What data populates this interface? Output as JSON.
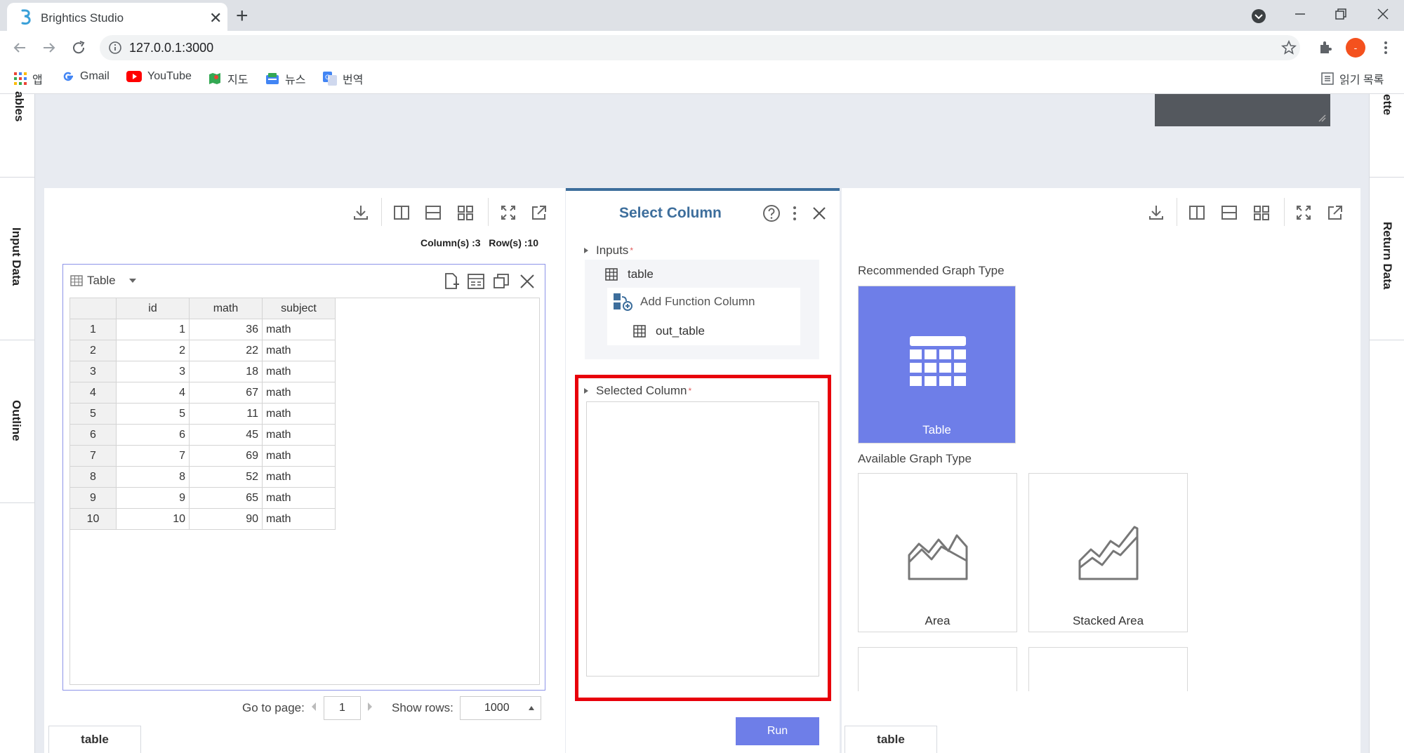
{
  "browser": {
    "tab_title": "Brightics Studio",
    "tab_close": "✕",
    "new_tab": "+",
    "url": "127.0.0.1:3000",
    "bookmarks": [
      "앱",
      "Gmail",
      "YouTube",
      "지도",
      "뉴스",
      "번역"
    ],
    "reading_list": "읽기 목록",
    "profile_initial": "-"
  },
  "rails": {
    "left": [
      "ables",
      "Input Data",
      "Outline"
    ],
    "right": [
      "ette",
      "Return Data"
    ]
  },
  "left_panel": {
    "summary": "Column(s) :3   Row(s) :10",
    "table_title": "Table",
    "columns": [
      "id",
      "math",
      "subject"
    ],
    "rows": [
      [
        "1",
        "1",
        "36",
        "math"
      ],
      [
        "2",
        "2",
        "22",
        "math"
      ],
      [
        "3",
        "3",
        "18",
        "math"
      ],
      [
        "4",
        "4",
        "67",
        "math"
      ],
      [
        "5",
        "5",
        "11",
        "math"
      ],
      [
        "6",
        "6",
        "45",
        "math"
      ],
      [
        "7",
        "7",
        "69",
        "math"
      ],
      [
        "8",
        "8",
        "52",
        "math"
      ],
      [
        "9",
        "9",
        "65",
        "math"
      ],
      [
        "10",
        "10",
        "90",
        "math"
      ]
    ],
    "goto_label": "Go to page:",
    "page_value": "1",
    "rows_label": "Show rows:",
    "rows_value": "1000",
    "bottom_tab": "table"
  },
  "center_panel": {
    "title": "Select Column",
    "inputs_label": "Inputs",
    "required_mark": "*",
    "input_table": "table",
    "add_function": "Add Function Column",
    "out_table": "out_table",
    "selected_label": "Selected Column",
    "run_label": "Run"
  },
  "right_panel": {
    "recommended_label": "Recommended Graph Type",
    "available_label": "Available Graph Type",
    "card_table": "Table",
    "card_area": "Area",
    "card_stacked_area": "Stacked Area",
    "bottom_tab": "table"
  },
  "colors": {
    "accent": "#6e7ee8",
    "title_blue": "#3d6e9c",
    "highlight_red": "#e8000b"
  }
}
